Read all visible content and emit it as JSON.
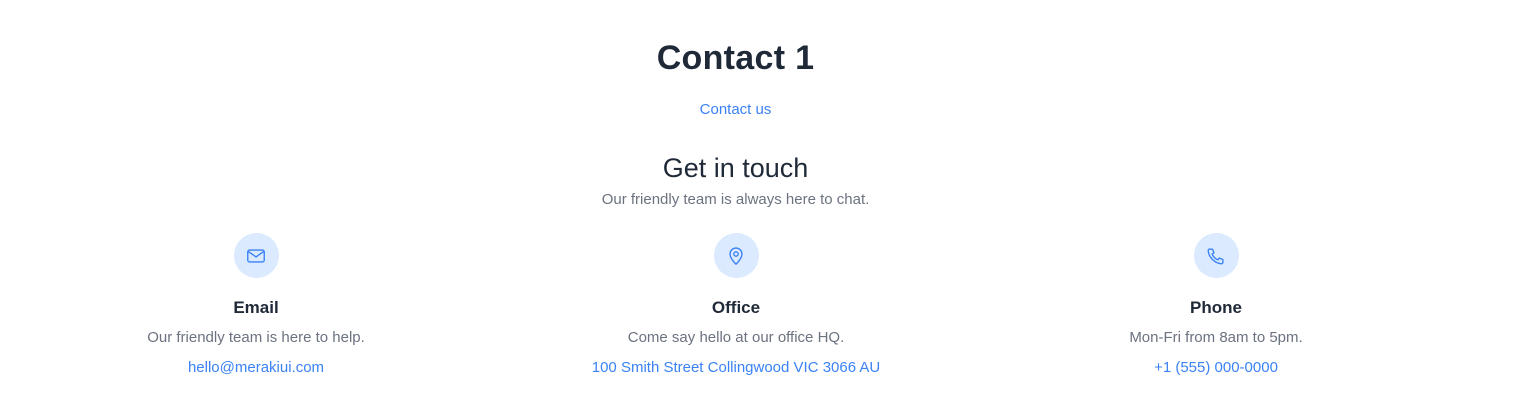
{
  "page_title": "Contact 1",
  "section": {
    "eyebrow": "Contact us",
    "heading": "Get in touch",
    "subtitle": "Our friendly team is always here to chat."
  },
  "cards": [
    {
      "icon": "envelope-icon",
      "title": "Email",
      "description": "Our friendly team is here to help.",
      "link": "hello@merakiui.com"
    },
    {
      "icon": "map-pin-icon",
      "title": "Office",
      "description": "Come say hello at our office HQ.",
      "link": "100 Smith Street Collingwood VIC 3066 AU"
    },
    {
      "icon": "phone-icon",
      "title": "Phone",
      "description": "Mon-Fri from 8am to 5pm.",
      "link": "+1 (555) 000-0000"
    }
  ],
  "colors": {
    "accent": "#3b82f6",
    "icon_background": "#dbeafe",
    "heading": "#1f2937",
    "muted_text": "#6b7280"
  }
}
